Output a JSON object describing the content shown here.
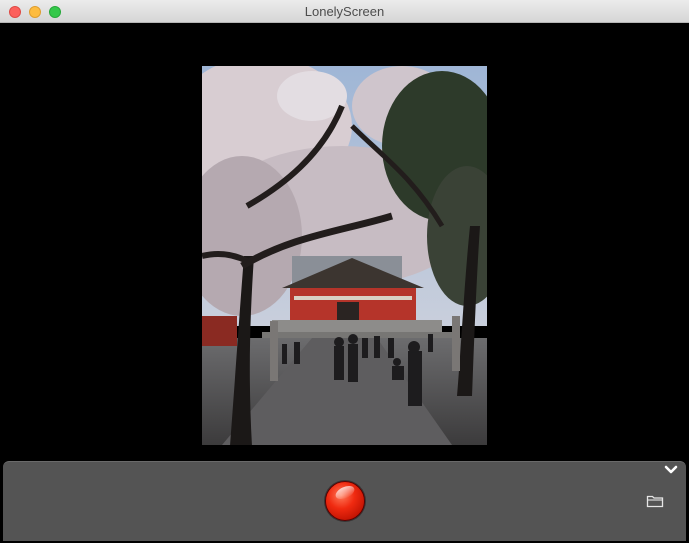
{
  "window": {
    "title": "LonelyScreen"
  },
  "controls": {
    "record_icon": "record-icon",
    "folder_icon": "folder-icon",
    "chevron_icon": "chevron-down-icon"
  },
  "colors": {
    "background": "#000000",
    "control_bar": "#545454",
    "record": "#e8260e"
  }
}
